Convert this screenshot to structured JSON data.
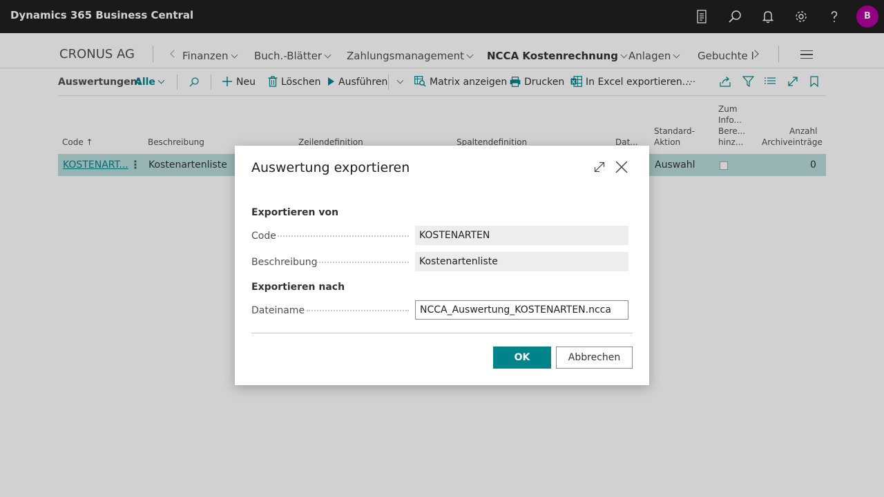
{
  "app": {
    "title": "Dynamics 365 Business Central",
    "user_initial": "B"
  },
  "colors": {
    "accent": "#00848a",
    "avatar": "#b4009e",
    "topbar": "#202020",
    "selected_row": "#b9dcdc"
  },
  "topbar_icons": [
    "document-icon",
    "search-icon",
    "bell-icon",
    "gear-icon",
    "help-icon"
  ],
  "nav": {
    "company": "CRONUS AG",
    "items": [
      "Finanzen",
      "Buch.-Blätter",
      "Zahlungsmanagement",
      "NCCA Kostenrechnung",
      "Anlagen",
      "Gebuchte I"
    ]
  },
  "actions": {
    "filter_label": "Auswertungen:",
    "filter_value": "Alle",
    "new": "Neu",
    "delete": "Löschen",
    "run": "Ausführen",
    "matrix": "Matrix anzeigen",
    "print": "Drucken",
    "excel": "In Excel exportieren...",
    "more": "···"
  },
  "table": {
    "headers": {
      "code": "Code ↑",
      "description": "Beschreibung",
      "row_def": "Zeilendefinition",
      "col_def": "Spaltendefinition",
      "date": "Dat...",
      "std_action_1": "Standard-",
      "std_action_2": "Aktion",
      "info_1": "Zum",
      "info_2": "Info...",
      "info_3": "Bere...",
      "info_4": "hinz...",
      "archive_1": "Anzahl",
      "archive_2": "Archiveinträge"
    },
    "rows": [
      {
        "code": "KOSTENART...",
        "description": "Kostenartenliste",
        "std_action": "Auswahl",
        "archive_count": "0"
      }
    ]
  },
  "dialog": {
    "title": "Auswertung exportieren",
    "section_from": "Exportieren von",
    "code_label": "Code",
    "code_value": "KOSTENARTEN",
    "desc_label": "Beschreibung",
    "desc_value": "Kostenartenliste",
    "section_to": "Exportieren nach",
    "file_label": "Dateiname",
    "file_value": "NCCA_Auswertung_KOSTENARTEN.ncca",
    "ok": "OK",
    "cancel": "Abbrechen"
  }
}
